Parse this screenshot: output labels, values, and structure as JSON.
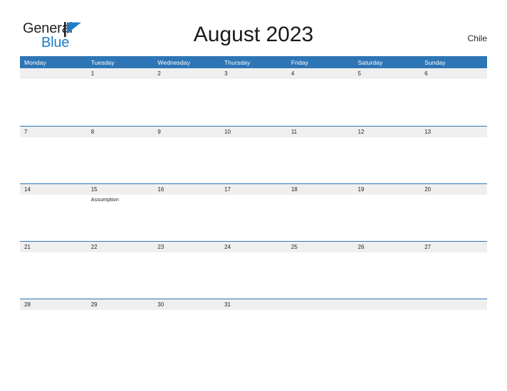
{
  "brand": {
    "name_line1": "General",
    "name_line2": "Blue",
    "flag_color": "#1f7cc4",
    "text_color": "#231f20"
  },
  "header": {
    "title": "August 2023",
    "country": "Chile"
  },
  "theme": {
    "header_blue": "#2e75b6",
    "date_strip_gray": "#efefef",
    "page_background": "#ffffff",
    "text_dark": "#231f20"
  },
  "calendar": {
    "weekdays": [
      "Monday",
      "Tuesday",
      "Wednesday",
      "Thursday",
      "Friday",
      "Saturday",
      "Sunday"
    ],
    "weeks": [
      {
        "days": [
          {
            "date": "",
            "event": ""
          },
          {
            "date": "1",
            "event": ""
          },
          {
            "date": "2",
            "event": ""
          },
          {
            "date": "3",
            "event": ""
          },
          {
            "date": "4",
            "event": ""
          },
          {
            "date": "5",
            "event": ""
          },
          {
            "date": "6",
            "event": ""
          }
        ]
      },
      {
        "days": [
          {
            "date": "7",
            "event": ""
          },
          {
            "date": "8",
            "event": ""
          },
          {
            "date": "9",
            "event": ""
          },
          {
            "date": "10",
            "event": ""
          },
          {
            "date": "11",
            "event": ""
          },
          {
            "date": "12",
            "event": ""
          },
          {
            "date": "13",
            "event": ""
          }
        ]
      },
      {
        "days": [
          {
            "date": "14",
            "event": ""
          },
          {
            "date": "15",
            "event": "Assumption"
          },
          {
            "date": "16",
            "event": ""
          },
          {
            "date": "17",
            "event": ""
          },
          {
            "date": "18",
            "event": ""
          },
          {
            "date": "19",
            "event": ""
          },
          {
            "date": "20",
            "event": ""
          }
        ]
      },
      {
        "days": [
          {
            "date": "21",
            "event": ""
          },
          {
            "date": "22",
            "event": ""
          },
          {
            "date": "23",
            "event": ""
          },
          {
            "date": "24",
            "event": ""
          },
          {
            "date": "25",
            "event": ""
          },
          {
            "date": "26",
            "event": ""
          },
          {
            "date": "27",
            "event": ""
          }
        ]
      },
      {
        "days": [
          {
            "date": "28",
            "event": ""
          },
          {
            "date": "29",
            "event": ""
          },
          {
            "date": "30",
            "event": ""
          },
          {
            "date": "31",
            "event": ""
          },
          {
            "date": "",
            "event": ""
          },
          {
            "date": "",
            "event": ""
          },
          {
            "date": "",
            "event": ""
          }
        ]
      }
    ]
  }
}
